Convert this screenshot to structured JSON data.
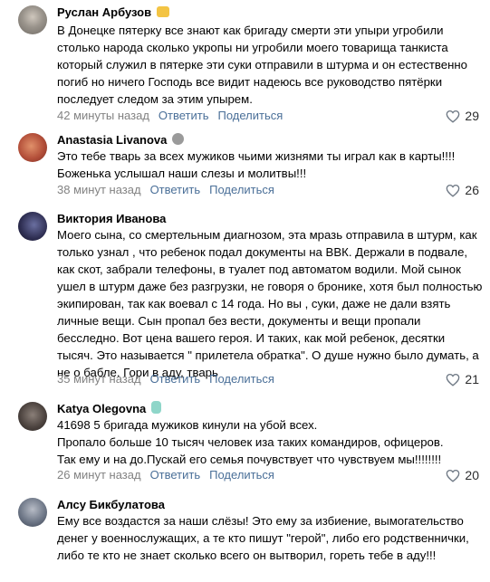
{
  "actions": {
    "reply": "Ответить",
    "share": "Поделиться"
  },
  "comments": [
    {
      "author": "Руслан Арбузов",
      "text": "В Донецке пятерку все знают как бригаду смерти эти упыри угробили столько народа сколько укропы ни угробили моего товарища танкиста который служил в пятерке эти суки отправили в штурма и он естественно погиб но ничего Господь все видит надеюсь все руководство пятёрки последует следом за этим упырем.",
      "time": "42 минуты назад",
      "likes": "29",
      "badge_icon": "muscle-emoji-icon"
    },
    {
      "author": "Anastasia Livanova",
      "text": "Это тебе тварь за всех мужиков чьими жизнями ты играл как в карты!!!!\nБоженька услышал наши слезы и молитвы!!!",
      "time": "38 минут назад",
      "likes": "26",
      "badge_icon": "raccoon-emoji-icon"
    },
    {
      "author": "Виктория Иванова",
      "text": "Моего сына, со смертельным диагнозом, эта мразь отправила в штурм, как только узнал , что ребенок подал документы на ВВК. Держали в подвале, как скот, забрали телефоны, в туалет под автоматом водили. Мой сынок ушел в штурм даже без разгрузки, не говоря о бронике, хотя был полностью экипирован, так как воевал с 14 года. Но вы , суки, даже не дали взять личные вещи. Сын пропал без вести, документы и вещи пропали бесследно. Вот цена вашего героя. И таких, как мой ребенок, десятки тысяч. Это называется \" прилетела обратка\". О душе нужно было думать, а не о бабле. Гори в аду, тварь",
      "time": "35 минут назад",
      "likes": "21"
    },
    {
      "author": "Katya Olegovna",
      "text": "41698 5 бригада мужиков кинули на убой всех.\nПропало больше 10 тысяч человек иза таких командиров, офицеров.\nТак ему и на до.Пускай его семья почувствует что чувствуем мы!!!!!!!!",
      "time": "26 минут назад",
      "likes": "20",
      "badge_icon": "baby-bottle-emoji-icon"
    },
    {
      "author": "Алсу Бикбулатова",
      "text": "Ему все воздастся за наши слёзы! Это ему за избиение, вымогательство денег у военнослужащих, а те кто пишут \"герой\", либо его родственнички, либо те кто не знает сколько всего он вытворил, гореть тебе в аду!!!"
    }
  ],
  "colors": {
    "link": "#4a6f98",
    "meta": "#828282",
    "background": "#ffffff"
  }
}
